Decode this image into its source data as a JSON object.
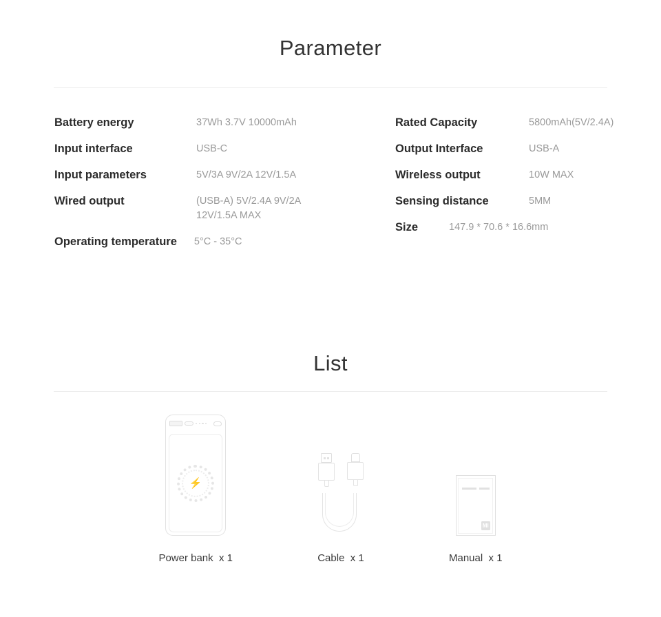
{
  "parameter": {
    "title": "Parameter",
    "left_rows": [
      {
        "label": "Battery energy",
        "value": "37Wh  3.7V  10000mAh"
      },
      {
        "label": "Input interface",
        "value": "USB-C"
      },
      {
        "label": "Input parameters",
        "value": "5V/3A   9V/2A  12V/1.5A"
      },
      {
        "label": "Wired output",
        "value": "(USB-A)  5V/2.4A  9V/2A\n12V/1.5A MAX"
      },
      {
        "label": "Operating temperature",
        "value": "5°C - 35°C"
      }
    ],
    "right_rows": [
      {
        "label": "Rated Capacity",
        "value": "5800mAh(5V/2.4A)"
      },
      {
        "label": "Output Interface",
        "value": "USB-A"
      },
      {
        "label": "Wireless output",
        "value": "10W MAX"
      },
      {
        "label": "Sensing distance",
        "value": "5MM"
      },
      {
        "label": "Size",
        "value": "147.9 * 70.6 * 16.6mm"
      }
    ]
  },
  "list": {
    "title": "List",
    "items": [
      {
        "label": "Power bank  x 1",
        "icon": "power-bank-illustration"
      },
      {
        "label": "Cable  x 1",
        "icon": "usb-cable-illustration"
      },
      {
        "label": "Manual  x 1",
        "icon": "manual-booklet-illustration"
      }
    ]
  },
  "colors": {
    "background": "#ffffff",
    "heading": "#333333",
    "label": "#2b2b2b",
    "value": "#9a9a9a",
    "divider": "#ececec",
    "illustration_line": "#e0e0e0"
  }
}
